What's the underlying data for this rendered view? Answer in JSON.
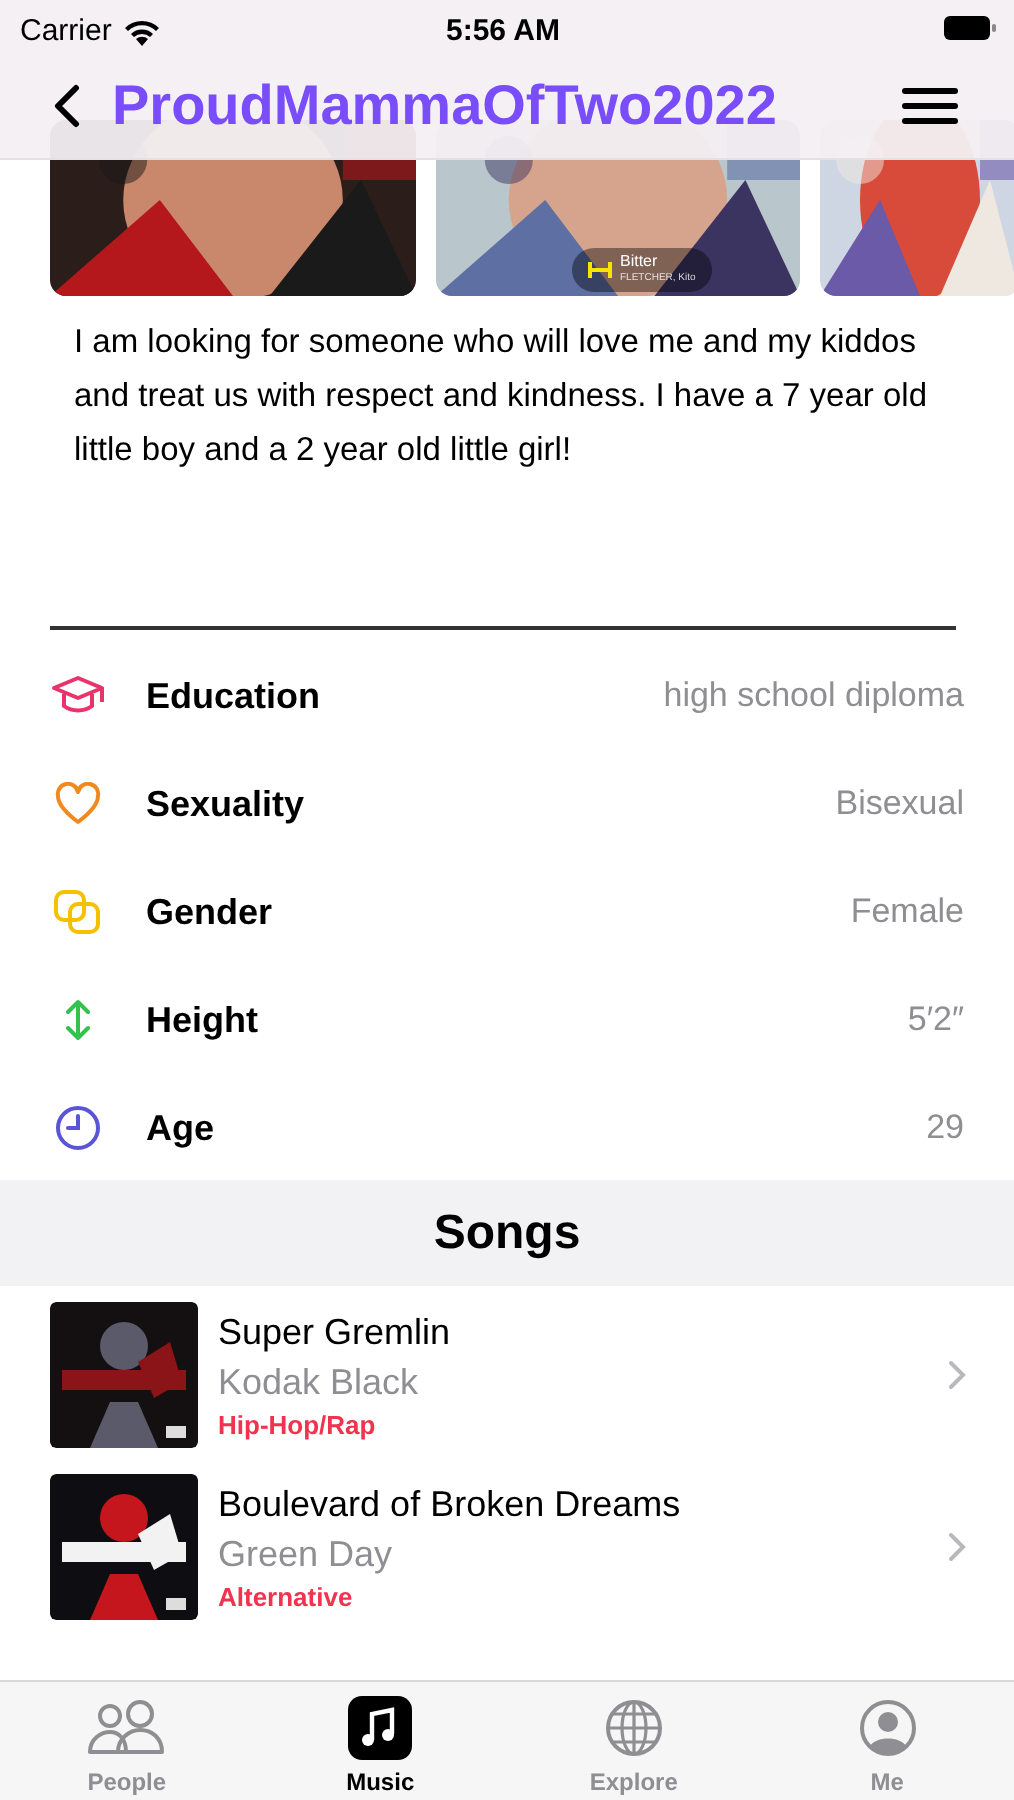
{
  "status_bar": {
    "carrier": "Carrier",
    "time": "5:56 AM"
  },
  "nav": {
    "title": "ProudMammaOfTwo2022"
  },
  "photos": [
    {
      "kind": "picture"
    },
    {
      "kind": "picture",
      "song": {
        "title": "Bitter",
        "artist": "FLETCHER, Kito"
      }
    },
    {
      "kind": "picture"
    }
  ],
  "bio": "I am looking for someone who will love me and my kiddos and treat us with respect and kindness. I have a 7 year old little boy and a 2 year old little girl!",
  "details": [
    {
      "kind": "education",
      "label": "Education",
      "value": "high school diploma",
      "color": "#e8336b"
    },
    {
      "kind": "sexuality",
      "label": "Sexuality",
      "value": "Bisexual",
      "color": "#f0891f"
    },
    {
      "kind": "gender",
      "label": "Gender",
      "value": "Female",
      "color": "#f5c000"
    },
    {
      "kind": "height",
      "label": "Height",
      "value": "5′2″",
      "color": "#32c24d"
    },
    {
      "kind": "age",
      "label": "Age",
      "value": "29",
      "color": "#5a55d6"
    }
  ],
  "songs_header": "Songs",
  "songs": [
    {
      "title": "Super Gremlin",
      "artist": "Kodak Black",
      "genre": "Hip-Hop/Rap"
    },
    {
      "title": "Boulevard of Broken Dreams",
      "artist": "Green Day",
      "genre": "Alternative"
    }
  ],
  "tabs": [
    {
      "kind": "people",
      "label": "People",
      "selected": false
    },
    {
      "kind": "music",
      "label": "Music",
      "selected": true
    },
    {
      "kind": "explore",
      "label": "Explore",
      "selected": false
    },
    {
      "kind": "me",
      "label": "Me",
      "selected": false
    }
  ]
}
